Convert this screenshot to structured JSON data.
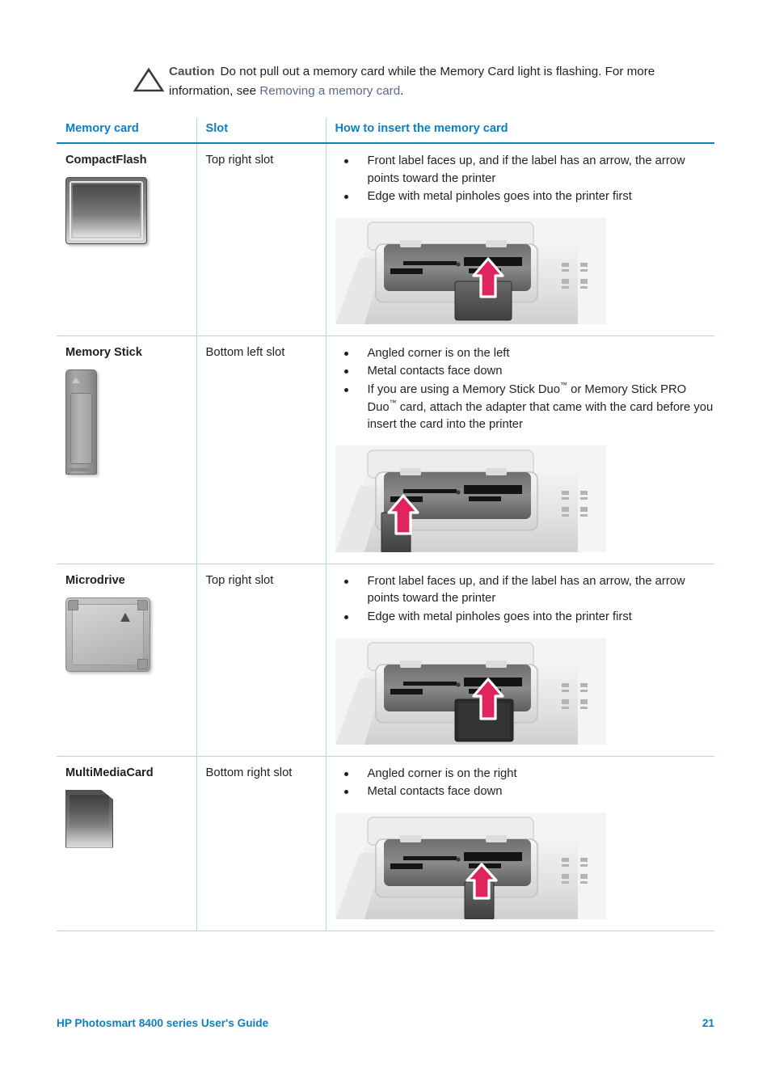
{
  "caution": {
    "icon": "warning-triangle-icon",
    "label": "Caution",
    "text_before_link": "Do not pull out a memory card while the Memory Card light is flashing. For more information, see ",
    "link_text": "Removing a memory card",
    "text_after_link": "."
  },
  "table": {
    "headers": [
      "Memory card",
      "Slot",
      "How to insert the memory card"
    ],
    "rows": [
      {
        "card": "CompactFlash",
        "card_icon": "compactflash-card-icon",
        "slot": "Top right slot",
        "instructions": [
          "Front label faces up, and if the label has an arrow, the arrow points toward the printer",
          "Edge with metal pinholes goes into the printer first"
        ],
        "figure": "printer-slot-top-right-illustration"
      },
      {
        "card": "Memory Stick",
        "card_icon": "memory-stick-card-icon",
        "slot": "Bottom left slot",
        "instructions": [
          "Angled corner is on the left",
          "Metal contacts face down",
          "If you are using a Memory Stick Duo™ or Memory Stick PRO Duo™ card, attach the adapter that came with the card before you insert the card into the printer"
        ],
        "figure": "printer-slot-bottom-left-illustration"
      },
      {
        "card": "Microdrive",
        "card_icon": "microdrive-card-icon",
        "slot": "Top right slot",
        "instructions": [
          "Front label faces up, and if the label has an arrow, the arrow points toward the printer",
          "Edge with metal pinholes goes into the printer first"
        ],
        "figure": "printer-slot-top-right-illustration"
      },
      {
        "card": "MultiMediaCard",
        "card_icon": "multimediacard-card-icon",
        "slot": "Bottom right slot",
        "instructions": [
          "Angled corner is on the right",
          "Metal contacts face down"
        ],
        "figure": "printer-slot-bottom-right-illustration"
      }
    ]
  },
  "footer": {
    "guide_title": "HP Photosmart 8400 series User's Guide",
    "page_number": "21"
  },
  "colors": {
    "heading_blue": "#0c80c3",
    "rule_blue": "#a9d9ef",
    "link_slate": "#5b6b87",
    "body_black": "#231f20",
    "arrow_magenta": "#e0245e"
  }
}
